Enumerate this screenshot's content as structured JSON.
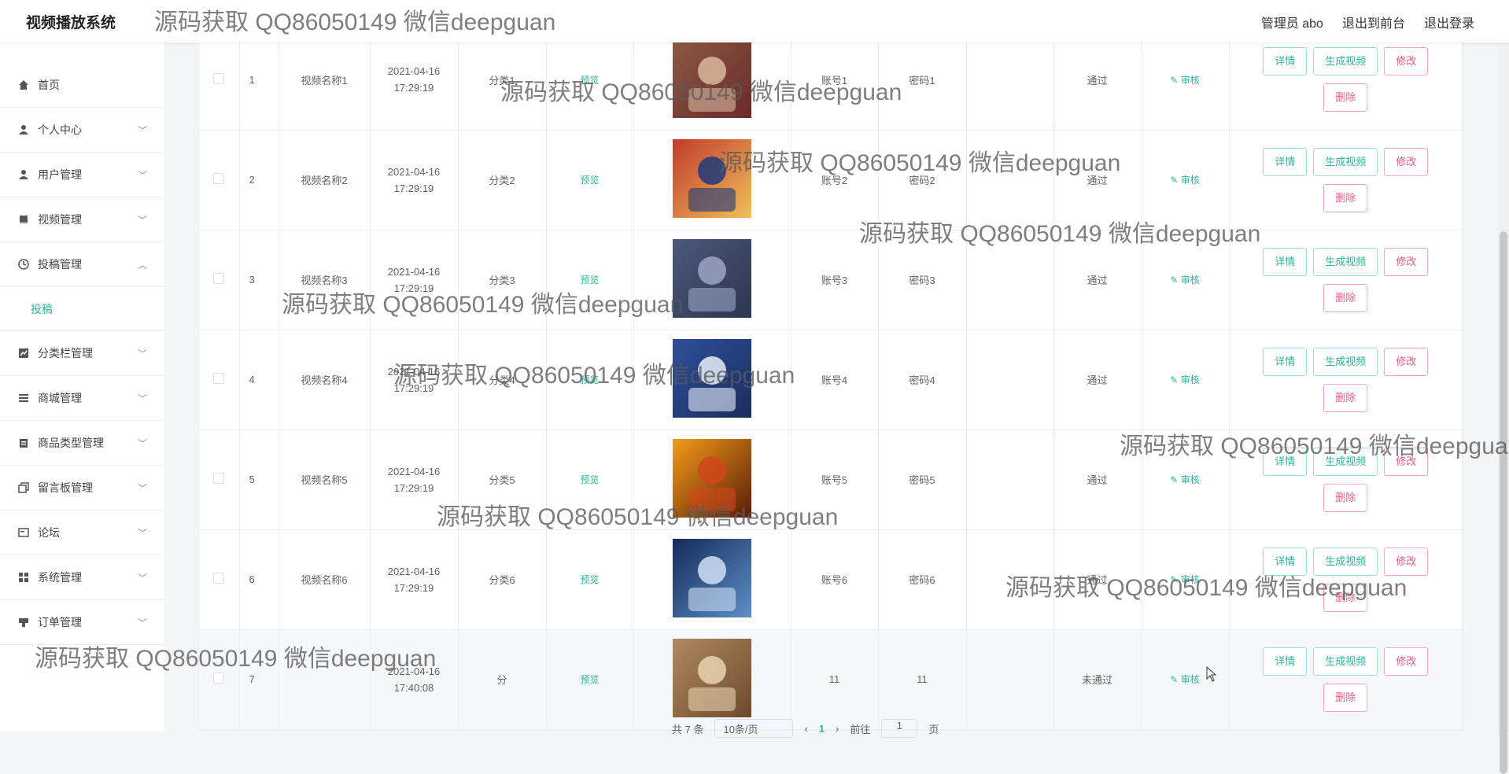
{
  "header": {
    "app_title": "视频播放系统",
    "user_label": "管理员 abo",
    "to_front": "退出到前台",
    "logout": "退出登录"
  },
  "sidebar": {
    "items": [
      {
        "label": "首页",
        "icon": "home-icon"
      },
      {
        "label": "个人中心",
        "icon": "user-icon"
      },
      {
        "label": "用户管理",
        "icon": "user-icon"
      },
      {
        "label": "视频管理",
        "icon": "book-icon"
      },
      {
        "label": "投稿管理",
        "icon": "clock-icon",
        "expanded": true,
        "sub": "投稿"
      },
      {
        "label": "分类栏管理",
        "icon": "chart-icon"
      },
      {
        "label": "商城管理",
        "icon": "list-icon"
      },
      {
        "label": "商品类型管理",
        "icon": "clipboard-icon"
      },
      {
        "label": "留言板管理",
        "icon": "copy-icon"
      },
      {
        "label": "论坛",
        "icon": "card-icon"
      },
      {
        "label": "系统管理",
        "icon": "grid-icon"
      },
      {
        "label": "订单管理",
        "icon": "stamp-icon"
      }
    ]
  },
  "table": {
    "preview_label": "预览",
    "audit_label": "审核",
    "btn_detail": "详情",
    "btn_generate": "生成视频",
    "btn_edit": "修改",
    "btn_delete": "删除",
    "rows": [
      {
        "idx": "1",
        "name": "视频名称1",
        "date": "2021-04-16",
        "time": "17:29:19",
        "category": "分类1",
        "account": "账号1",
        "password": "密码1",
        "status": "通过"
      },
      {
        "idx": "2",
        "name": "视频名称2",
        "date": "2021-04-16",
        "time": "17:29:19",
        "category": "分类2",
        "account": "账号2",
        "password": "密码2",
        "status": "通过"
      },
      {
        "idx": "3",
        "name": "视频名称3",
        "date": "2021-04-16",
        "time": "17:29:19",
        "category": "分类3",
        "account": "账号3",
        "password": "密码3",
        "status": "通过"
      },
      {
        "idx": "4",
        "name": "视频名称4",
        "date": "2021-04-16",
        "time": "17:29:19",
        "category": "分类4",
        "account": "账号4",
        "password": "密码4",
        "status": "通过"
      },
      {
        "idx": "5",
        "name": "视频名称5",
        "date": "2021-04-16",
        "time": "17:29:19",
        "category": "分类5",
        "account": "账号5",
        "password": "密码5",
        "status": "通过"
      },
      {
        "idx": "6",
        "name": "视频名称6",
        "date": "2021-04-16",
        "time": "17:29:19",
        "category": "分类6",
        "account": "账号6",
        "password": "密码6",
        "status": "通过"
      },
      {
        "idx": "7",
        "name": "",
        "date": "2021-04-16",
        "time": "17:40:08",
        "category": "分",
        "account": "11",
        "password": "11",
        "status": "未通过"
      }
    ]
  },
  "pager": {
    "total": "共 7 条",
    "page_size": "10条/页",
    "current": "1",
    "goto_label": "前往",
    "goto_value": "1",
    "page_unit": "页"
  },
  "watermark": "源码获取 QQ86050149 微信deepguan",
  "colors": {
    "accent": "#2bb59a",
    "danger": "#e85c88"
  }
}
